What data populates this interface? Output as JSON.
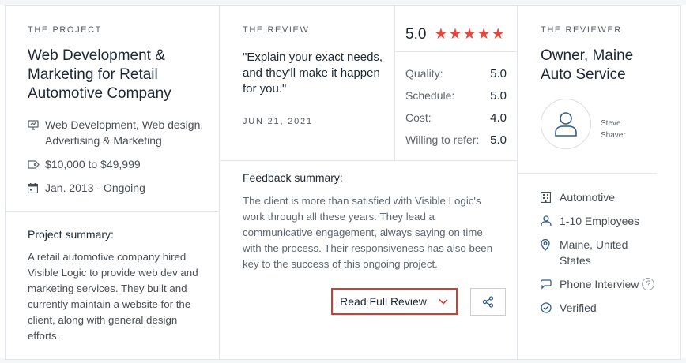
{
  "project": {
    "eyebrow": "THE PROJECT",
    "title": "Web Development & Marketing for Retail Automotive Company",
    "services": "Web Development, Web design, Advertising & Marketing",
    "budget": "$10,000 to $49,999",
    "dates": "Jan. 2013 - Ongoing",
    "summary_label": "Project summary:",
    "summary_text": "A retail automotive company hired Visible Logic to provide web dev and marketing services. They built and currently maintain a website for the client, along with general design efforts."
  },
  "review": {
    "eyebrow": "THE REVIEW",
    "quote": "\"Explain your exact needs, and they'll make it happen for you.\"",
    "date": "JUN 21, 2021",
    "overall_score": "5.0",
    "star_count": 5,
    "scores": [
      {
        "label": "Quality:",
        "value": "5.0"
      },
      {
        "label": "Schedule:",
        "value": "5.0"
      },
      {
        "label": "Cost:",
        "value": "4.0"
      },
      {
        "label": "Willing to refer:",
        "value": "5.0"
      }
    ],
    "feedback_label": "Feedback summary:",
    "feedback_text": "The client is more than satisfied with Visible Logic's work through all these years. They lead a communicative engagement, always saying on time with the process. Their responsiveness has also been key to the success of this ongoing project.",
    "read_button": "Read Full Review"
  },
  "reviewer": {
    "eyebrow": "THE REVIEWER",
    "title": "Owner, Maine Auto Service",
    "name_first": "Steve",
    "name_last": "Shaver",
    "industry": "Automotive",
    "employees": "1-10 Employees",
    "location": "Maine, United States",
    "interview": "Phone Interview",
    "help_glyph": "?",
    "verified": "Verified"
  },
  "colors": {
    "accent_red": "#e8463b",
    "button_border": "#e2372c",
    "divider": "#e2e6ea"
  }
}
